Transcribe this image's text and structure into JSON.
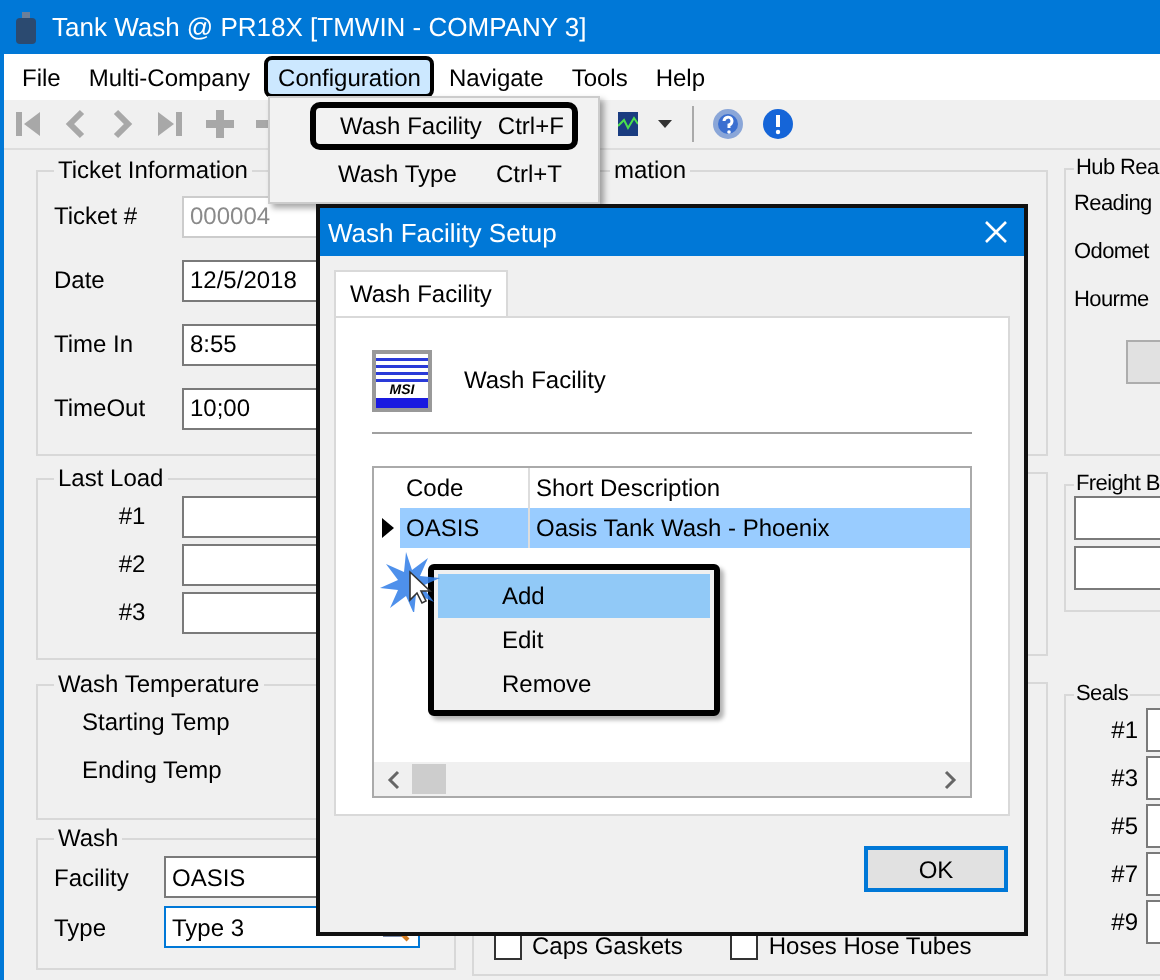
{
  "window": {
    "title": "Tank Wash @ PR18X [TMWIN - COMPANY 3]"
  },
  "menubar": [
    {
      "label": "File",
      "selected": false
    },
    {
      "label": "Multi-Company",
      "selected": false
    },
    {
      "label": "Configuration",
      "selected": true
    },
    {
      "label": "Navigate",
      "selected": false
    },
    {
      "label": "Tools",
      "selected": false
    },
    {
      "label": "Help",
      "selected": false
    }
  ],
  "menu_dropdown": {
    "items": [
      {
        "label": "Wash Facility",
        "shortcut": "Ctrl+F",
        "highlighted": true
      },
      {
        "label": "Wash Type",
        "shortcut": "Ctrl+T",
        "highlighted": false
      }
    ]
  },
  "ticket_information": {
    "title": "Ticket Information",
    "fields": [
      {
        "label": "Ticket #",
        "value": "000004",
        "disabled": true
      },
      {
        "label": "Date",
        "value": "12/5/2018",
        "disabled": false
      },
      {
        "label": "Time In",
        "value": "8:55",
        "disabled": false
      },
      {
        "label": "TimeOut",
        "value": "10;00",
        "disabled": false
      }
    ]
  },
  "middle_group": {
    "title": "mation"
  },
  "last_load": {
    "title": "Last Load",
    "rows": [
      {
        "label": "#1"
      },
      {
        "label": "#2"
      },
      {
        "label": "#3"
      }
    ]
  },
  "wash_temperature": {
    "title": "Wash Temperature",
    "labels": [
      "Starting Temp",
      "Ending Temp"
    ]
  },
  "wash": {
    "title": "Wash",
    "facility": {
      "label": "Facility",
      "value": "OASIS"
    },
    "type": {
      "label": "Type",
      "value": "Type 3",
      "focused": true
    }
  },
  "checkboxes": [
    {
      "label": "Caps Gaskets",
      "checked": false
    },
    {
      "label": "Hoses Hose Tubes",
      "checked": false
    }
  ],
  "hub_readings": {
    "title": "Hub Rea",
    "labels": [
      "Reading",
      "Odomet",
      "Hourme"
    ]
  },
  "freight_bill": {
    "title": "Freight B"
  },
  "seals": {
    "title": "Seals",
    "labels": [
      "#1",
      "#3",
      "#5",
      "#7",
      "#9"
    ]
  },
  "dialog": {
    "title": "Wash Facility Setup",
    "tabs": [
      {
        "label": "Wash Facility",
        "selected": true
      }
    ],
    "heading": "Wash Facility",
    "logo_text": "MSI",
    "grid": {
      "columns": [
        "Code",
        "Short Description"
      ],
      "rows": [
        {
          "cells": [
            "OASIS",
            "Oasis Tank Wash - Phoenix"
          ],
          "selected": true
        }
      ]
    },
    "context_menu": {
      "items": [
        {
          "label": "Add",
          "selected": true
        },
        {
          "label": "Edit",
          "selected": false
        },
        {
          "label": "Remove",
          "selected": false
        }
      ]
    },
    "ok_button": "OK"
  }
}
